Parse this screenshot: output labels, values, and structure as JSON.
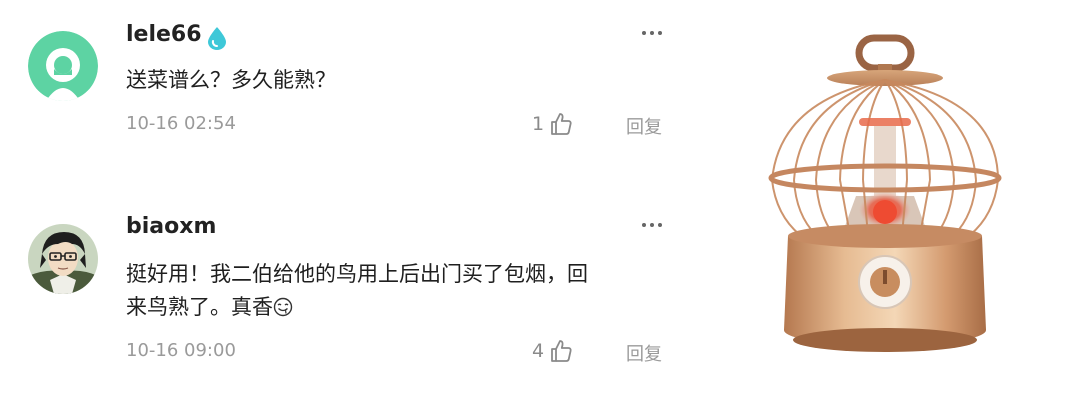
{
  "comments": [
    {
      "username": "lele66",
      "badge_icon": "water-drop-icon",
      "avatar_icon": "default-avatar-icon",
      "content": "送菜谱么？多久能熟？",
      "time": "10-16 02:54",
      "likes": "1",
      "reply_label": "回复"
    },
    {
      "username": "biaoxm",
      "avatar_icon": "anime-glasses-avatar-icon",
      "content_line1": "挺好用！我二伯给他的鸟用上后出门买了包烟，回",
      "content_line2": "来鸟熟了。真香",
      "emoji_icon": "drooling-emoji-icon",
      "time": "10-16 09:00",
      "likes": "4",
      "reply_label": "回复"
    }
  ],
  "product_image": "birdcage-heater-image",
  "colors": {
    "avatar_green": "#5dd3a3",
    "meta_gray": "#9a9a9a",
    "badge_blue": "#3ec8d8",
    "product_gold": "#c9956a"
  }
}
